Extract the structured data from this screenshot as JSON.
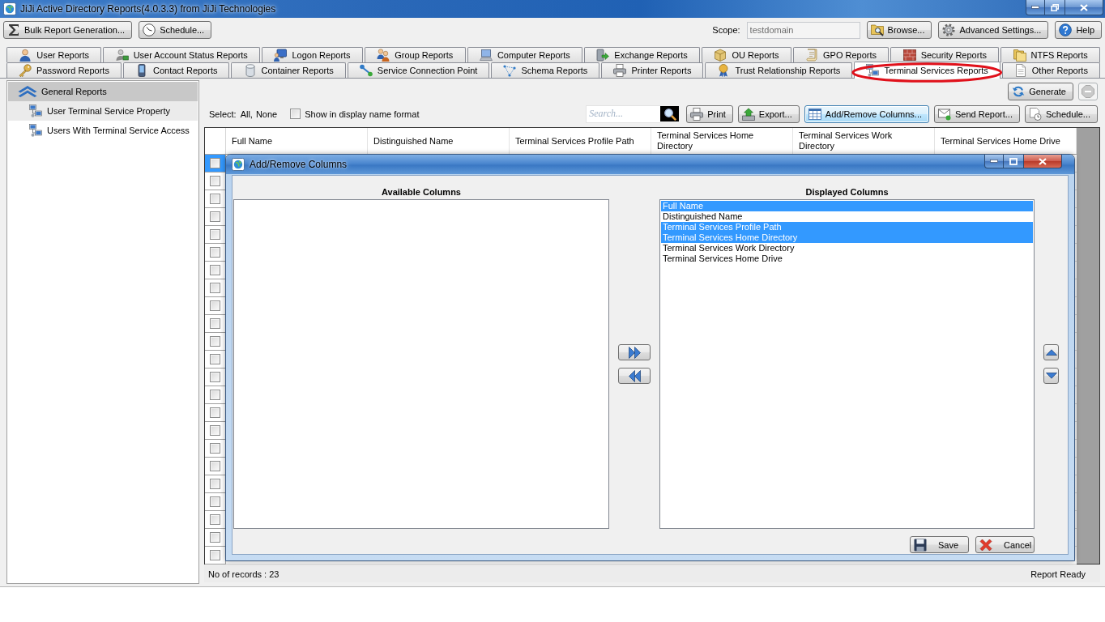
{
  "window": {
    "title": "JiJi Active Directory Reports(4.0.3.3) from JiJi Technologies"
  },
  "toolbar": {
    "left_buttons": [
      "Bulk Report Generation...",
      "Schedule..."
    ],
    "scope": {
      "label": "Scope:",
      "value": "testdomain",
      "disabled": true
    },
    "right_buttons": [
      "Browse...",
      "Advanced Settings...",
      "Help"
    ]
  },
  "tab_rows": [
    {
      "tabs": [
        {
          "label": "User Reports",
          "selected": false,
          "circled": false
        },
        {
          "label": "User Account Status Reports",
          "selected": false,
          "circled": false
        },
        {
          "label": "Logon Reports",
          "selected": false,
          "circled": false
        },
        {
          "label": "Group Reports",
          "selected": false,
          "circled": false
        },
        {
          "label": "Computer Reports",
          "selected": false,
          "circled": false
        },
        {
          "label": "Exchange Reports",
          "selected": false,
          "circled": false
        },
        {
          "label": "OU Reports",
          "selected": false,
          "circled": false
        },
        {
          "label": "GPO Reports",
          "selected": false,
          "circled": false
        },
        {
          "label": "Security Reports",
          "selected": false,
          "circled": false
        },
        {
          "label": "NTFS Reports",
          "selected": false,
          "circled": false
        }
      ]
    },
    {
      "tabs": [
        {
          "label": "Password Reports",
          "selected": false,
          "circled": false
        },
        {
          "label": "Contact Reports",
          "selected": false,
          "circled": false
        },
        {
          "label": "Container Reports",
          "selected": false,
          "circled": false
        },
        {
          "label": "Service Connection Point",
          "selected": false,
          "circled": false
        },
        {
          "label": "Schema Reports",
          "selected": false,
          "circled": false
        },
        {
          "label": "Printer Reports",
          "selected": false,
          "circled": false
        },
        {
          "label": "Trust Relationship Reports",
          "selected": false,
          "circled": false
        },
        {
          "label": "Terminal Services Reports",
          "selected": true,
          "circled": true
        },
        {
          "label": "Other Reports",
          "selected": false,
          "circled": false
        }
      ]
    }
  ],
  "sidebar": {
    "group": {
      "title": "General Reports",
      "expanded": true
    },
    "items": [
      {
        "label": "User Terminal Service Property",
        "selected": true
      },
      {
        "label": "Users With Terminal Service Access",
        "selected": false
      }
    ]
  },
  "report": {
    "generate_button": "Generate",
    "stop_button": {
      "disabled": true
    },
    "select": {
      "label": "Select:",
      "links": [
        "All,",
        "None"
      ]
    },
    "display_name_option": {
      "label": "Show in display name format",
      "checked": false
    },
    "search": {
      "placeholder": "Search..."
    },
    "buttons": [
      {
        "label": "Print",
        "active": false
      },
      {
        "label": "Export...",
        "active": false
      },
      {
        "label": "Add/Remove Columns...",
        "active": true
      },
      {
        "label": "Send Report...",
        "active": false
      },
      {
        "label": "Schedule...",
        "active": false
      }
    ],
    "grid": {
      "columns": [
        "Full Name",
        "Distinguished Name",
        "Terminal Services Profile Path",
        "Terminal Services Home Directory",
        "Terminal Services Work Directory",
        "Terminal Services Home Drive"
      ],
      "rows": [
        {
          "selected": true,
          "checked": false
        },
        {
          "selected": false,
          "checked": false
        },
        {
          "selected": false,
          "checked": false
        },
        {
          "selected": false,
          "checked": false
        },
        {
          "selected": false,
          "checked": false
        },
        {
          "selected": false,
          "checked": false
        },
        {
          "selected": false,
          "checked": false
        },
        {
          "selected": false,
          "checked": false
        },
        {
          "selected": false,
          "checked": false
        },
        {
          "selected": false,
          "checked": false
        },
        {
          "selected": false,
          "checked": false
        },
        {
          "selected": false,
          "checked": false
        },
        {
          "selected": false,
          "checked": false
        },
        {
          "selected": false,
          "checked": false
        },
        {
          "selected": false,
          "checked": false
        },
        {
          "selected": false,
          "checked": false
        },
        {
          "selected": false,
          "checked": false
        },
        {
          "selected": false,
          "checked": false
        },
        {
          "selected": false,
          "checked": false
        },
        {
          "selected": false,
          "checked": false
        },
        {
          "selected": false,
          "checked": false
        },
        {
          "selected": false,
          "checked": false
        },
        {
          "selected": false,
          "checked": false
        }
      ]
    }
  },
  "dialog": {
    "title": "Add/Remove Columns",
    "available": {
      "title": "Available Columns"
    },
    "displayed": {
      "title": "Displayed Columns",
      "items": [
        {
          "label": "Full Name",
          "selected": true
        },
        {
          "label": "Distinguished Name",
          "selected": false
        },
        {
          "label": "Terminal Services Profile Path",
          "selected": true
        },
        {
          "label": "Terminal Services Home Directory",
          "selected": true
        },
        {
          "label": "Terminal Services Work Directory",
          "selected": false
        },
        {
          "label": "Terminal Services Home Drive",
          "selected": false
        }
      ]
    },
    "buttons": [
      "Save",
      "Cancel"
    ]
  },
  "status_bar": {
    "records": "No of records : 23",
    "status": "Report Ready"
  }
}
